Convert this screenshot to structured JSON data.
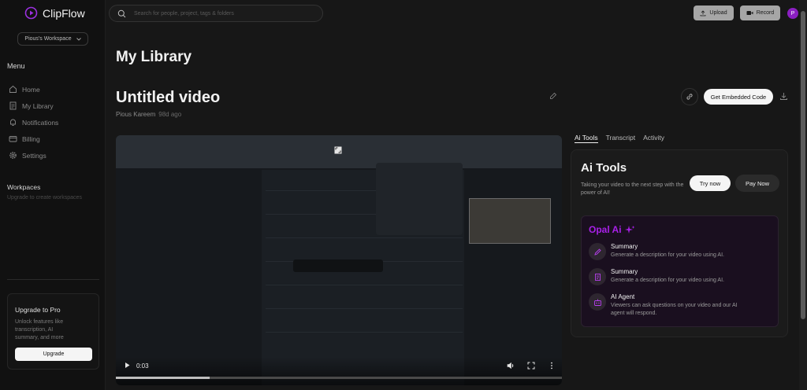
{
  "app": {
    "name": "ClipFlow"
  },
  "sidebar": {
    "workspace": "Pious's Workspace",
    "menu_title": "Menu",
    "items": [
      {
        "label": "Home",
        "icon": "home-icon"
      },
      {
        "label": "My Library",
        "icon": "document-icon"
      },
      {
        "label": "Notifications",
        "icon": "bell-icon"
      },
      {
        "label": "Billing",
        "icon": "credit-card-icon"
      },
      {
        "label": "Settings",
        "icon": "gear-icon"
      }
    ],
    "workspaces_title": "Workpaces",
    "workspaces_sub": "Upgrade to create workspaces",
    "upgrade": {
      "title": "Upgrade to Pro",
      "desc": "Unlock features like transcription, AI summary, and more",
      "button": "Upgrade"
    }
  },
  "topbar": {
    "search_placeholder": "Search for people, project, tags & folders",
    "upload_label": "Upload",
    "record_label": "Record",
    "avatar_initial": "P"
  },
  "main": {
    "page_title": "My Library",
    "video_title": "Untitled video",
    "author": "Pious Kareem",
    "ago": "98d ago",
    "embed_label": "Get Embedded Code"
  },
  "player": {
    "time": "0:03",
    "progress": 0.21
  },
  "tabs": [
    "Ai Tools",
    "Transcript",
    "Activity"
  ],
  "ai": {
    "title": "Ai Tools",
    "desc": "Taking your video to the next step with the power of AI!",
    "try_label": "Try now",
    "pay_label": "Pay Now",
    "opal_title": "Opal Ai",
    "features": [
      {
        "title": "Summary",
        "desc": "Generate a description for your video using AI.",
        "icon": "pen-icon"
      },
      {
        "title": "Summary",
        "desc": "Generate a description for your video using AI.",
        "icon": "file-text-icon"
      },
      {
        "title": "AI Agent",
        "desc": "Viewers can ask questions on your video and our AI agent will respond.",
        "icon": "bot-icon"
      }
    ]
  },
  "colors": {
    "accent": "#a820e8",
    "avatar": "#8b1fc2"
  }
}
